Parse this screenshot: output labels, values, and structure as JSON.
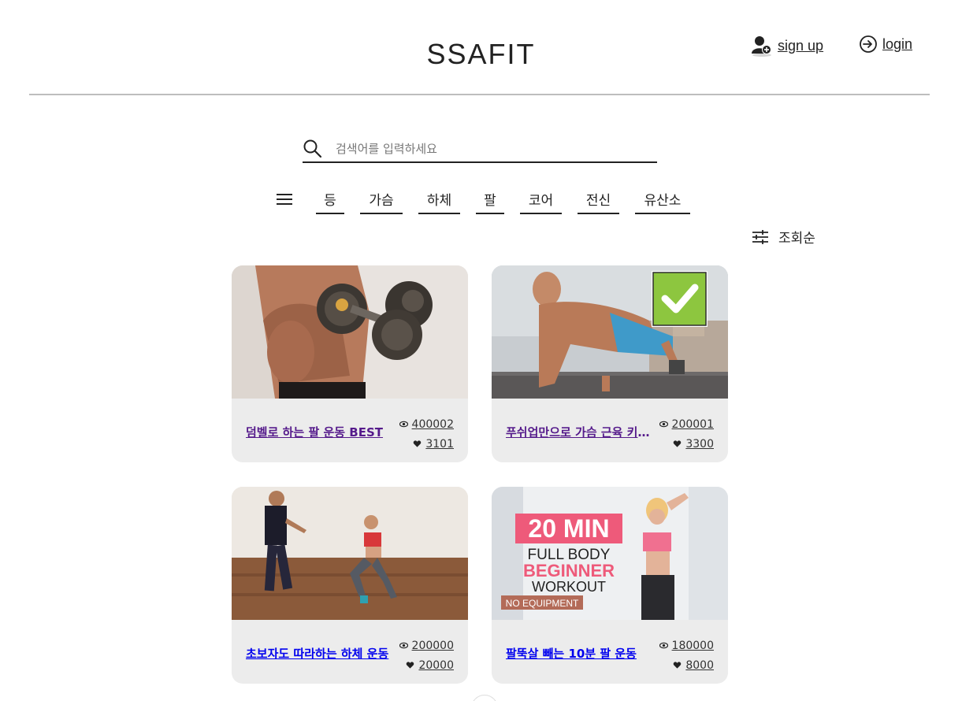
{
  "header": {
    "logo": "SSAFIT",
    "signup_label": "sign up",
    "login_label": "login"
  },
  "search": {
    "placeholder": "검색어를 입력하세요"
  },
  "categories": [
    "등",
    "가슴",
    "하체",
    "팔",
    "코어",
    "전신",
    "유산소"
  ],
  "sort": {
    "label": "조회순"
  },
  "videos": [
    {
      "title": "덤벨로 하는 팔 운동 BEST",
      "views": "400002",
      "likes": "3101",
      "visited": true
    },
    {
      "title": "푸쉬업만으로 가슴 근육 키우기",
      "views": "200001",
      "likes": "3300",
      "visited": true
    },
    {
      "title": "초보자도 따라하는 하체 운동",
      "views": "200000",
      "likes": "20000",
      "visited": false
    },
    {
      "title": "팔뚝살 빼는 10분 팔 운동",
      "views": "180000",
      "likes": "8000",
      "visited": false,
      "thumb_text": {
        "line1": "20 MIN",
        "line2": "FULL BODY",
        "line3": "BEGINNER",
        "line4": "WORKOUT",
        "tag": "NO EQUIPMENT"
      }
    }
  ],
  "colors": {
    "accent_text": "#222222",
    "card_bg": "#ececec",
    "visited_link": "#551a8b",
    "fresh_link": "#0000ee",
    "check_green": "#8dc63f"
  }
}
